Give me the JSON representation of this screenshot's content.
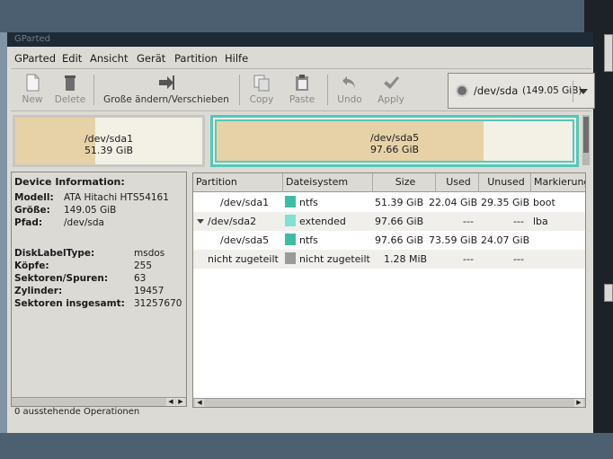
{
  "window": {
    "title": "GParted"
  },
  "menu": [
    {
      "label": "GParted",
      "mnemonic": "G"
    },
    {
      "label": "Edit",
      "mnemonic": "E"
    },
    {
      "label": "Ansicht",
      "mnemonic": "A"
    },
    {
      "label": "Gerät",
      "mnemonic": "r"
    },
    {
      "label": "Partition",
      "mnemonic": "P"
    },
    {
      "label": "Hilfe",
      "mnemonic": "H"
    }
  ],
  "toolbar": {
    "new": "New",
    "delete": "Delete",
    "resize": "Große ändern/Verschieben",
    "copy": "Copy",
    "paste": "Paste",
    "undo": "Undo",
    "apply": "Apply"
  },
  "device_selector": {
    "name": "/dev/sda",
    "size": "(149.05 GiB)"
  },
  "disk_map": [
    {
      "name": "/dev/sda1",
      "size": "51.39 GiB",
      "used_fraction": 0.43,
      "selected": false
    },
    {
      "name": "/dev/sda5",
      "size": "97.66 GiB",
      "used_fraction": 0.75,
      "selected": true
    }
  ],
  "device_info": {
    "title": "Device Information:",
    "rows1": [
      {
        "label": "Modell:",
        "value": "ATA Hitachi HTS54161"
      },
      {
        "label": "Größe:",
        "value": "149.05 GiB"
      },
      {
        "label": "Pfad:",
        "value": "/dev/sda"
      }
    ],
    "rows2": [
      {
        "label": "DiskLabelType:",
        "value": "msdos"
      },
      {
        "label": "Köpfe:",
        "value": "255"
      },
      {
        "label": "Sektoren/Spuren:",
        "value": "63"
      },
      {
        "label": "Zylinder:",
        "value": "19457"
      },
      {
        "label": "Sektoren insgesamt:",
        "value": "31257670"
      }
    ]
  },
  "table": {
    "columns": [
      "Partition",
      "Dateisystem",
      "Size",
      "Used",
      "Unused",
      "Markierunge"
    ],
    "rows": [
      {
        "partition": "/dev/sda1",
        "fs": "ntfs",
        "fs_color": "#3fbca6",
        "size": "51.39 GiB",
        "used": "22.04 GiB",
        "unused": "29.35 GiB",
        "flags": "boot"
      },
      {
        "partition": "/dev/sda2",
        "fs": "extended",
        "fs_color": "#7fe0d4",
        "size": "97.66 GiB",
        "used": "---",
        "unused": "---",
        "flags": "lba"
      },
      {
        "partition": "/dev/sda5",
        "fs": "ntfs",
        "fs_color": "#3fbca6",
        "size": "97.66 GiB",
        "used": "73.59 GiB",
        "unused": "24.07 GiB",
        "flags": ""
      },
      {
        "partition": "nicht zugeteilt",
        "fs": "nicht zugeteilt",
        "fs_color": "#9a9a9a",
        "size": "1.28 MiB",
        "used": "---",
        "unused": "---",
        "flags": ""
      }
    ]
  },
  "status": "0 ausstehende Operationen"
}
